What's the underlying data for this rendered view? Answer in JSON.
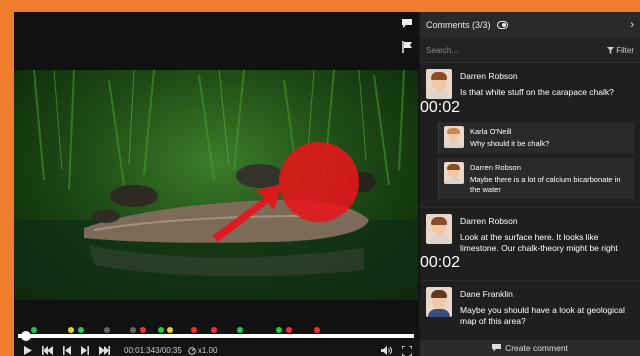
{
  "player": {
    "current_time": "00:01:343/00:35",
    "playback_rate": "x1.00",
    "markers": [
      {
        "pos": 0.04,
        "color": "#23c15a"
      },
      {
        "pos": 0.135,
        "color": "#e1d728"
      },
      {
        "pos": 0.16,
        "color": "#2dc84f"
      },
      {
        "pos": 0.225,
        "color": "#666666"
      },
      {
        "pos": 0.29,
        "color": "#666666"
      },
      {
        "pos": 0.315,
        "color": "#ff2b2b"
      },
      {
        "pos": 0.36,
        "color": "#22cc44"
      },
      {
        "pos": 0.385,
        "color": "#e1d728"
      },
      {
        "pos": 0.445,
        "color": "#ff2b2b"
      },
      {
        "pos": 0.495,
        "color": "#ff2b2b"
      },
      {
        "pos": 0.56,
        "color": "#22cc44"
      },
      {
        "pos": 0.66,
        "color": "#22cc44"
      },
      {
        "pos": 0.685,
        "color": "#ff2b2b"
      },
      {
        "pos": 0.755,
        "color": "#ff2b2b"
      }
    ],
    "progress": 0.02
  },
  "panel": {
    "title": "Comments (3/3)",
    "search_placeholder": "Search...",
    "filter_label": "Filter",
    "create_label": "Create comment"
  },
  "comments": [
    {
      "author": "Darren Robson",
      "text": "Is that white stuff on the carapace chalk?",
      "time": "00:02",
      "replies": [
        {
          "author": "Karla O'Neill",
          "text": "Why should it be chalk?"
        },
        {
          "author": "Darren Robson",
          "text": "Maybe there is a lot of calcium bicarbonate in the water"
        }
      ]
    },
    {
      "author": "Darren Robson",
      "text": "Look at the surface here. It looks like limestone. Our chalk-theory might be right",
      "time": "00:02",
      "replies": []
    },
    {
      "author": "Dane Franklin",
      "text": "Maybe you should have a look at geological map of this area?",
      "time": "",
      "replies": []
    }
  ],
  "colors": {
    "accent": "#f07d2e",
    "annotation_red": "#e8141a"
  }
}
